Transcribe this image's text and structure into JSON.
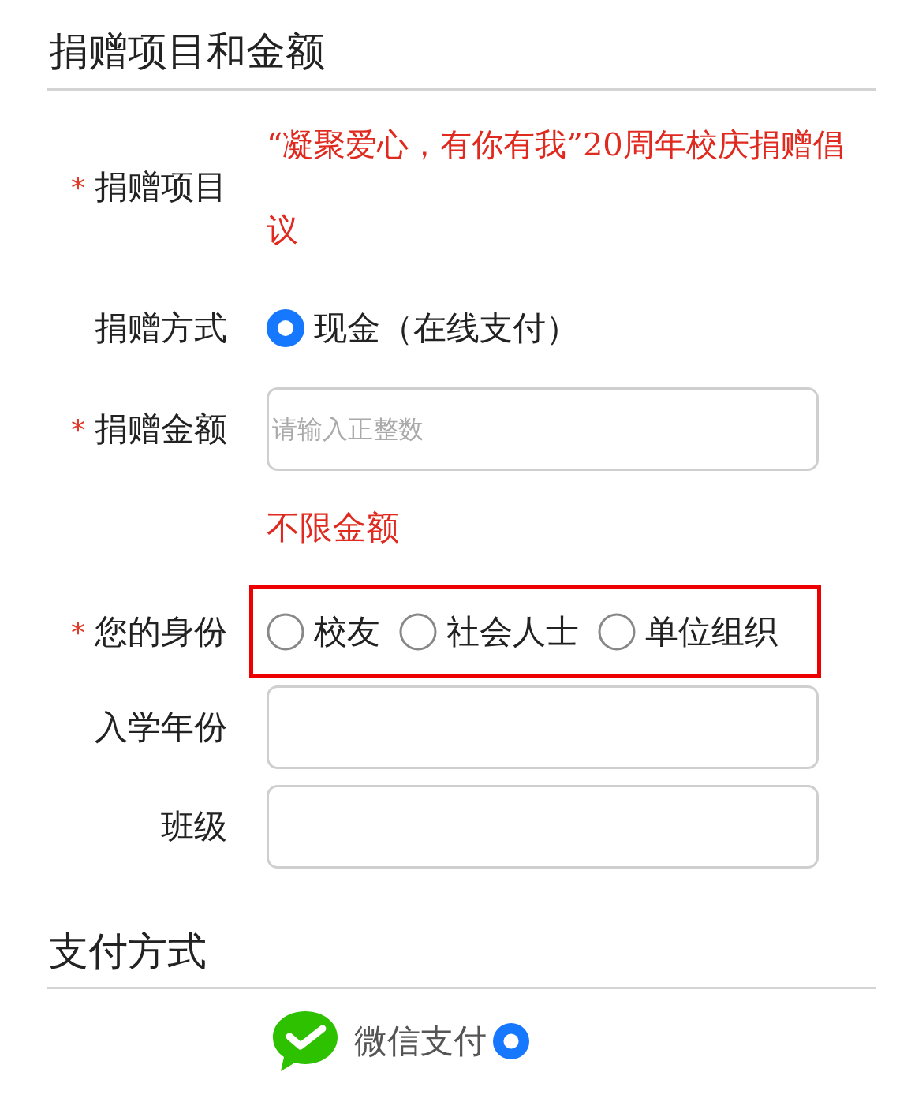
{
  "sections": [
    {
      "title": "捐赠项目和金额",
      "rows": [
        {
          "kind": "text",
          "label": "捐赠项目",
          "marker": "*",
          "value": "“凝聚爱心，有你有我”20周年校庆捐赠倡议"
        },
        {
          "kind": "radio",
          "label": "捐赠方式",
          "options": [
            {
              "label": "现金（在线支付）",
              "selected": true
            }
          ]
        },
        {
          "kind": "input",
          "label": "捐赠金额",
          "marker": "*",
          "placeholder": "请输入正整数"
        },
        {
          "kind": "note",
          "value": "不限金额"
        },
        {
          "kind": "radio",
          "label": "您的身份",
          "marker": "*",
          "highlighted": true,
          "options": [
            {
              "label": "校友",
              "selected": false
            },
            {
              "label": "社会人士",
              "selected": false
            },
            {
              "label": "单位组织",
              "selected": false
            }
          ]
        },
        {
          "kind": "input",
          "label": "入学年份"
        },
        {
          "kind": "input",
          "label": "班级"
        }
      ]
    }
  ],
  "payment": {
    "title": "支付方式",
    "options": [
      {
        "label": "微信支付",
        "selected": true
      }
    ]
  }
}
